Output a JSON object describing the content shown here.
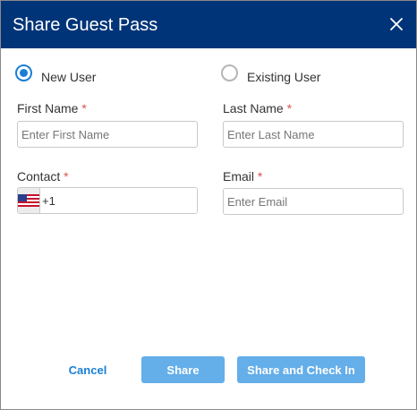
{
  "dialog": {
    "title": "Share Guest Pass",
    "close_icon": "close-icon"
  },
  "user_type": {
    "options": [
      {
        "label": "New User",
        "selected": true
      },
      {
        "label": "Existing User",
        "selected": false
      }
    ]
  },
  "fields": {
    "first_name": {
      "label": "First Name",
      "required_mark": "*",
      "placeholder": "Enter First Name",
      "value": ""
    },
    "last_name": {
      "label": "Last Name",
      "required_mark": "*",
      "placeholder": "Enter Last Name",
      "value": ""
    },
    "contact": {
      "label": "Contact",
      "required_mark": "*",
      "country_flag_icon": "us-flag-icon",
      "dial_code": "+1"
    },
    "email": {
      "label": "Email",
      "required_mark": "*",
      "placeholder": "Enter Email",
      "value": ""
    }
  },
  "actions": {
    "cancel_label": "Cancel",
    "share_label": "Share",
    "share_checkin_label": "Share and Check In"
  },
  "colors": {
    "header_bg": "#003478",
    "accent": "#1a7fd4",
    "primary_button": "#64aee9",
    "required": "#d9534f"
  }
}
